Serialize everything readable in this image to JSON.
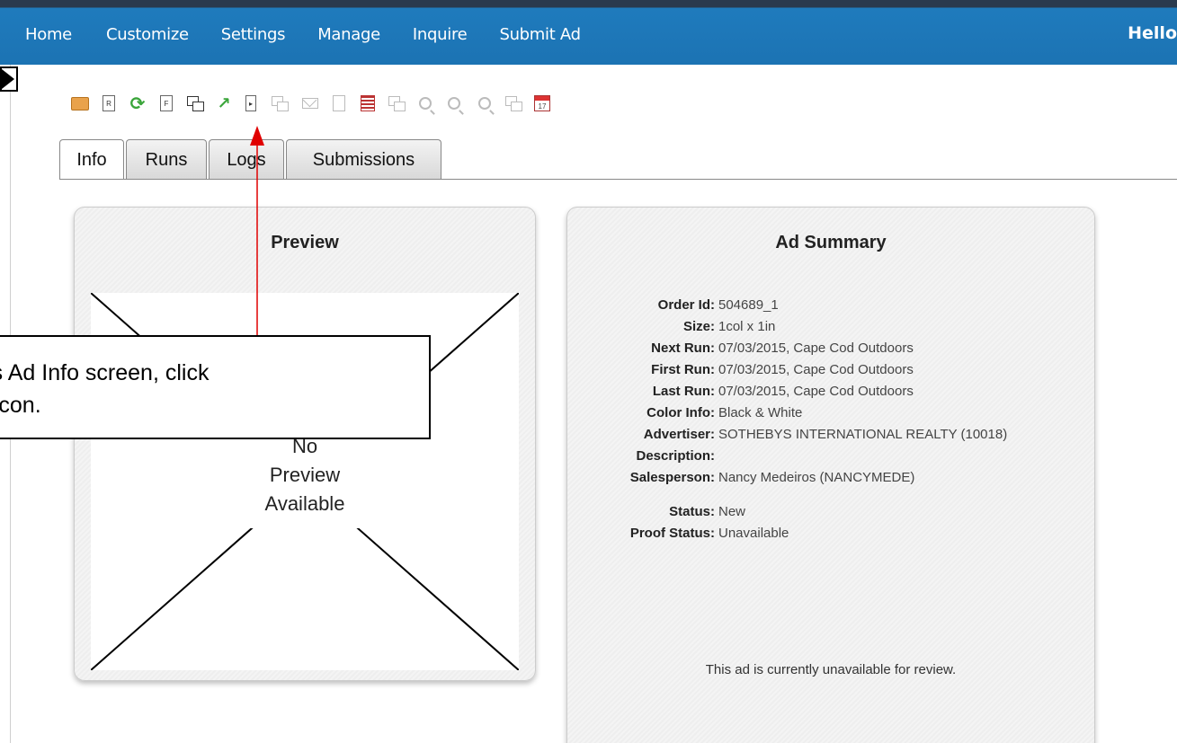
{
  "nav": {
    "items": [
      "Home",
      "Customize",
      "Settings",
      "Manage",
      "Inquire",
      "Submit Ad"
    ],
    "greeting": "Hello"
  },
  "toolbar": {
    "icons": [
      "folder-icon",
      "report-icon",
      "refresh-icon",
      "form-icon",
      "proof-icon",
      "upload-icon",
      "export-icon",
      "copy-icon",
      "mail-icon",
      "document-icon",
      "grid-icon",
      "duplicate-icon",
      "zoom-icon",
      "zoom-detail-icon",
      "zoom-out-icon",
      "view-icon",
      "calendar-icon"
    ],
    "calendar_day": "17"
  },
  "tabs": [
    "Info",
    "Runs",
    "Logs",
    "Submissions"
  ],
  "preview": {
    "title": "Preview",
    "line1": "No",
    "line2": "Preview",
    "line3": "Available"
  },
  "summary": {
    "title": "Ad Summary",
    "rows": [
      {
        "label": "Order Id:",
        "value": "504689_1"
      },
      {
        "label": "Size:",
        "value": "1col x 1in"
      },
      {
        "label": "Next Run:",
        "value": "07/03/2015, Cape Cod Outdoors"
      },
      {
        "label": "First Run:",
        "value": "07/03/2015, Cape Cod Outdoors"
      },
      {
        "label": "Last Run:",
        "value": "07/03/2015, Cape Cod Outdoors"
      },
      {
        "label": "Color Info:",
        "value": "Black & White"
      },
      {
        "label": "Advertiser:",
        "value": "SOTHEBYS INTERNATIONAL REALTY (10018)"
      },
      {
        "label": "Description:",
        "value": ""
      },
      {
        "label": "Salesperson:",
        "value": "Nancy Medeiros (NANCYMEDE)"
      },
      {
        "label": "Status:",
        "value": "New"
      },
      {
        "label": "Proof Status:",
        "value": "Unavailable"
      }
    ],
    "note": "This ad is currently unavailable for review."
  },
  "callout": {
    "line1": "d's Ad Info screen, click",
    "line2": "d icon."
  },
  "colors": {
    "nav_bg": "#1c73b3",
    "arrow": "#e00000"
  }
}
